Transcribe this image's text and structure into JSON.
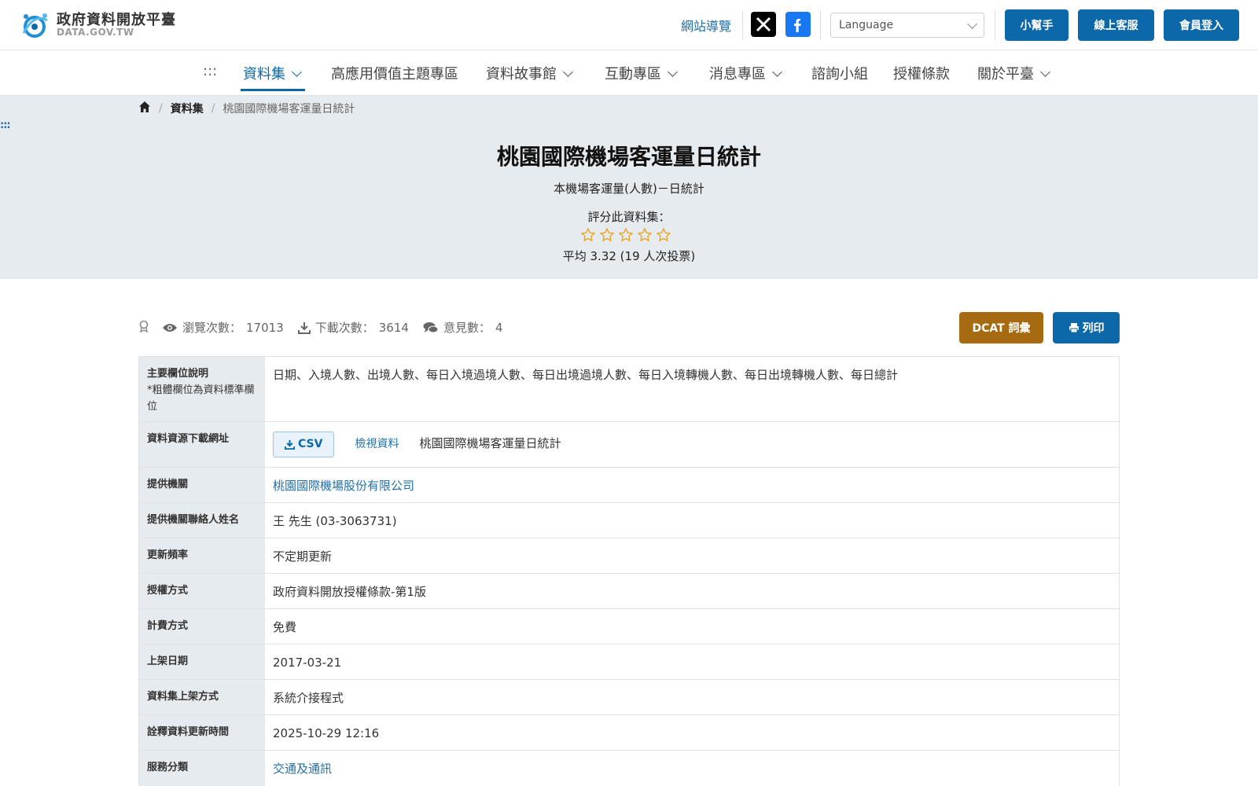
{
  "header": {
    "logo_title": "政府資料開放平臺",
    "logo_sub": "DATA.GOV.TW",
    "site_nav": "網站導覽",
    "language_placeholder": "Language",
    "btn_helper": "小幫手",
    "btn_service": "線上客服",
    "btn_login": "會員登入"
  },
  "mainnav": {
    "skip": ":::",
    "items": [
      {
        "label": "資料集"
      },
      {
        "label": "高應用價值主題專區"
      },
      {
        "label": "資料故事館"
      },
      {
        "label": "互動專區"
      },
      {
        "label": "消息專區"
      },
      {
        "label": "諮詢小組"
      },
      {
        "label": "授權條款"
      },
      {
        "label": "關於平臺"
      }
    ]
  },
  "breadcrumb": {
    "level1": "資料集",
    "current": "桃園國際機場客運量日統計"
  },
  "hero": {
    "skip": ":::",
    "title": "桃園國際機場客運量日統計",
    "description": "本機場客運量(人數)－日統計",
    "rate_label": "評分此資料集：",
    "rating_average": 3.32,
    "rating_stars_total": 5,
    "rate_avg_text": "平均 3.32 (19 人次投票)"
  },
  "stats": {
    "views_label": "瀏覽次數：",
    "views": "17013",
    "downloads_label": "下載次數：",
    "downloads": "3614",
    "comments_label": "意見數：",
    "comments": "4",
    "btn_dcat": "DCAT 詞彙",
    "btn_print": "列印"
  },
  "info": {
    "fields_label": "主要欄位說明",
    "fields_note": "*粗體欄位為資料標準欄位",
    "fields_value": "日期、入境人數、出境人數、每日入境過境人數、每日出境過境人數、每日入境轉機人數、每日出境轉機人數、每日總計",
    "download_label": "資料資源下載網址",
    "csv_label": "CSV",
    "view_label": "檢視資料",
    "resource_name": "桃園國際機場客運量日統計",
    "provider_label": "提供機關",
    "provider_value": "桃園國際機場股份有限公司",
    "contact_label": "提供機關聯絡人姓名",
    "contact_value": "王 先生 (03-3063731)",
    "freq_label": "更新頻率",
    "freq_value": "不定期更新",
    "license_label": "授權方式",
    "license_value": "政府資料開放授權條款-第1版",
    "fee_label": "計費方式",
    "fee_value": "免費",
    "publish_label": "上架日期",
    "publish_value": "2017-03-21",
    "method_label": "資料集上架方式",
    "method_value": "系統介接程式",
    "meta_update_label": "詮釋資料更新時間",
    "meta_update_value": "2025-10-29 12:16",
    "category_label": "服務分類",
    "category_value": "交通及通訊"
  },
  "colors": {
    "primary": "#0c68a8",
    "dcat": "#a66a10",
    "hero_bg": "#e6ebf0",
    "star": "#e8a317"
  }
}
